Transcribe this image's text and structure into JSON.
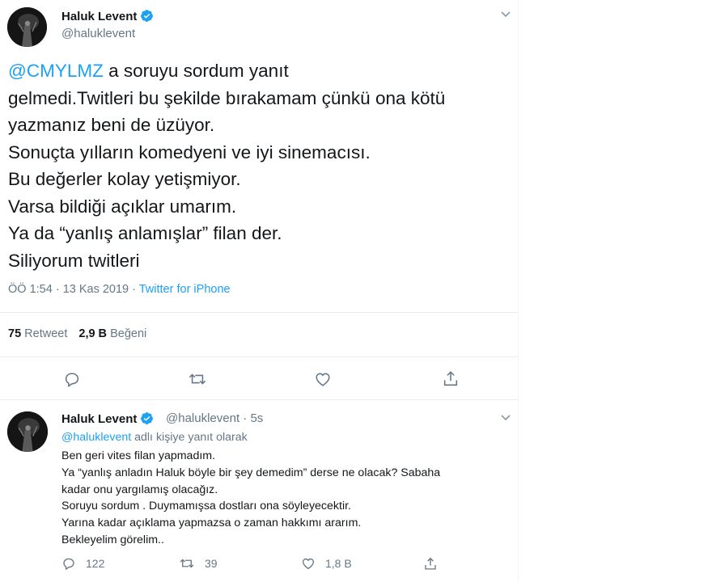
{
  "tweet": {
    "author_name": "Haluk Levent",
    "author_handle": "@haluklevent",
    "mention": "@CMYLMZ",
    "line1_rest": " a soruyu sordum yanıt",
    "lines": [
      "gelmedi.Twitleri bu şekilde bırakamam çünkü ona kötü",
      "yazmanız beni de üzüyor.",
      "Sonuçta yılların komedyeni ve iyi sinemacısı.",
      "Bu değerler kolay yetişmiyor.",
      "Varsa bildiği açıklar umarım.",
      "Ya da “yanlış anlamışlar” filan der.",
      "Siliyorum twitleri"
    ],
    "time": "ÖÖ 1:54 · 13 Kas 2019 · ",
    "source": "Twitter for iPhone",
    "retweet_count": "75",
    "retweet_label": "Retweet",
    "like_count": "2,9 B",
    "like_label": "Beğeni",
    "icons": [
      "reply-icon",
      "retweet-icon",
      "like-icon",
      "share-icon",
      "chevron-down-icon",
      "verified-badge-icon"
    ]
  },
  "reply": {
    "author_name": "Haluk Levent",
    "author_handle": "@haluklevent",
    "time_ago": "· 5s",
    "replying_mention": "@haluklevent",
    "replying_suffix": " adlı kişiye yanıt olarak",
    "lines": [
      "Ben geri vites filan yapmadım.",
      "Ya “yanlış anladın Haluk böyle bir şey demedim” derse ne olacak? Sabaha",
      "kadar onu yargılamış olacağız.",
      "Soruyu sordum . Duymamışsa dostları ona söyleyecektir.",
      "Yarına kadar açıklama yapmazsa o zaman hakkımı ararım.",
      "Bekleyelim görelim.."
    ],
    "reply_count": "122",
    "retweet_count": "39",
    "like_count": "1,8 B"
  },
  "colors": {
    "accent": "#1da1f2",
    "text": "#14171a",
    "secondary": "#657786",
    "divider": "#e6ecf0"
  }
}
